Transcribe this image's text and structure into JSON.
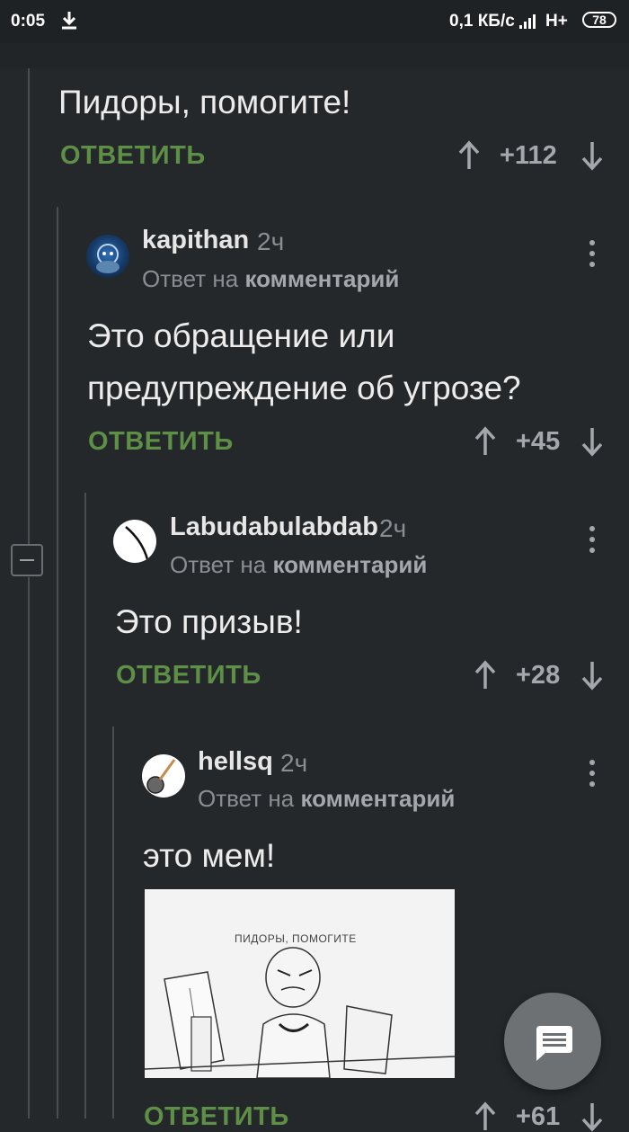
{
  "status_bar": {
    "time": "0:05",
    "network_speed": "0,1 КБ/с",
    "network_type": "H+",
    "battery": "78"
  },
  "root_comment": {
    "text": "Пидоры, помогите!",
    "reply_label": "ОТВЕТИТЬ",
    "score": "+112"
  },
  "comments": [
    {
      "username": "kapithan",
      "time": "2ч",
      "reply_to_prefix": "Ответ на",
      "reply_to_link": "комментарий",
      "text_lines": [
        "Это обращение или",
        "предупреждение об угрозе?"
      ],
      "reply_label": "ОТВЕТИТЬ",
      "score": "+45"
    },
    {
      "username": "Labudabulabdab",
      "time": "2ч",
      "reply_to_prefix": "Ответ на",
      "reply_to_link": "комментарий",
      "text": "Это призыв!",
      "reply_label": "ОТВЕТИТЬ",
      "score": "+28"
    },
    {
      "username": "hellsq",
      "time": "2ч",
      "reply_to_prefix": "Ответ на",
      "reply_to_link": "комментарий",
      "text": "это мем!",
      "image_caption": "ПИДОРЫ, ПОМОГИТЕ",
      "reply_label": "ОТВЕТИТЬ",
      "score": "+61"
    }
  ],
  "icons": {
    "download": "download-icon",
    "upvote": "arrow-up-icon",
    "downvote": "arrow-down-icon",
    "menu": "more-vert-icon",
    "collapse": "minus-icon",
    "fab": "chat-icon"
  },
  "colors": {
    "background": "#25282b",
    "reply_green": "#5d8f46",
    "muted_text": "#8a8e92",
    "fab": "#6e7174"
  }
}
